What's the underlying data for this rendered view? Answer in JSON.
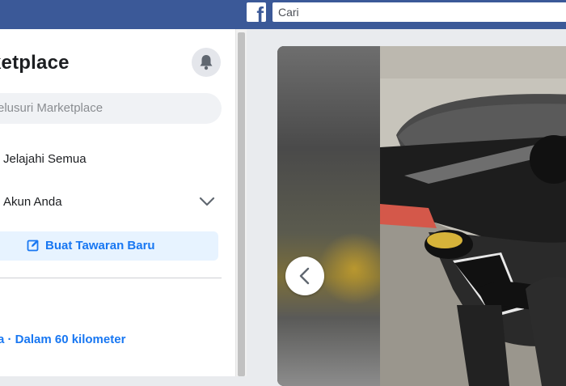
{
  "topbar": {
    "logo_icon": "facebook-logo-icon",
    "search_placeholder": "Cari"
  },
  "sidebar": {
    "title": "Marketplace",
    "title_visible": "ketplace",
    "notifications_icon": "bell-icon",
    "search_placeholder": "Jelusuri Marketplace",
    "search_visible": "elusuri Marketplace",
    "items": [
      {
        "label": "Jelajahi Semua"
      },
      {
        "label": "Akun Anda",
        "icon": "chevron-down-icon"
      }
    ],
    "create_button": {
      "label": "Buat Tawaran Baru",
      "icon": "edit-icon"
    },
    "location_text": "a · Dalam 60 kilometer"
  },
  "viewer": {
    "prev_icon": "chevron-left-icon",
    "photo_subject": "motorcycle rear with censored license plate"
  },
  "colors": {
    "brand": "#3b5998",
    "accent": "#1877f2",
    "button_bg": "#e7f3ff"
  }
}
